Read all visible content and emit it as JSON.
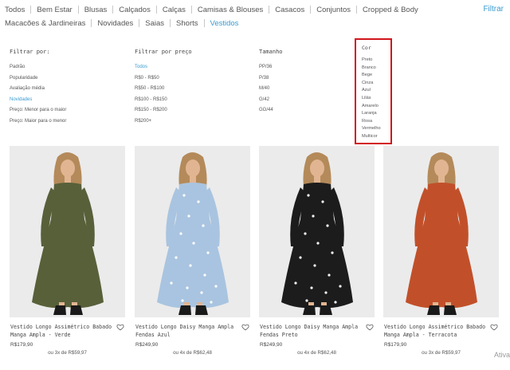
{
  "categories_row1": [
    "Todos",
    "Bem Estar",
    "Blusas",
    "Calçados",
    "Calças",
    "Camisas & Blouses",
    "Casacos",
    "Conjuntos",
    "Cropped & Body"
  ],
  "categories_row2": [
    "Macacões & Jardineiras",
    "Novidades",
    "Saias",
    "Shorts",
    "Vestidos"
  ],
  "active_category": "Vestidos",
  "filter_button": "Filtrar",
  "filters": {
    "sort": {
      "heading": "Filtrar por:",
      "options": [
        "Padrão",
        "Popularidade",
        "Avaliação média",
        "Novidades",
        "Preço: Menor para o maior",
        "Preço: Maior para o menor"
      ],
      "active": "Novidades"
    },
    "price": {
      "heading": "Filtrar por preço",
      "options": [
        "Todos",
        "R$0 - R$50",
        "R$50 - R$100",
        "R$100 - R$150",
        "R$150 - R$200",
        "R$200+"
      ],
      "active": "Todos"
    },
    "size": {
      "heading": "Tamanho",
      "options": [
        "PP/36",
        "P/38",
        "M/40",
        "G/42",
        "GG/44"
      ]
    },
    "color": {
      "heading": "Cor",
      "options": [
        "Preto",
        "Branco",
        "Bege",
        "Cinza",
        "Azul",
        "Lilás",
        "Amarelo",
        "Laranja",
        "Rosa",
        "Vermelho",
        "Multicor"
      ]
    }
  },
  "products": [
    {
      "name": "Vestido Longo Assimétrico Babado Manga Ampla - Verde",
      "price": "R$179,90",
      "installments": "ou 3x de R$59,97",
      "dress_color": "#58603a",
      "pattern": "solid"
    },
    {
      "name": "Vestido Longo Daisy Manga Ampla Fendas Azul",
      "price": "R$249,90",
      "installments": "ou 4x de R$62,48",
      "dress_color": "#a9c4e0",
      "pattern": "floral-light"
    },
    {
      "name": "Vestido Longo Daisy Manga Ampla Fendas Preto",
      "price": "R$249,90",
      "installments": "ou 4x de R$62,48",
      "dress_color": "#1c1c1c",
      "pattern": "floral-dark"
    },
    {
      "name": "Vestido Longo Assimétrico Babado Manga Ampla - Terracota",
      "price": "R$179,90",
      "installments": "ou 3x de R$59,97",
      "dress_color": "#c1502a",
      "pattern": "solid"
    }
  ],
  "icons": {
    "wishlist": "heart-outline-icon"
  },
  "watermark": "Ativa"
}
